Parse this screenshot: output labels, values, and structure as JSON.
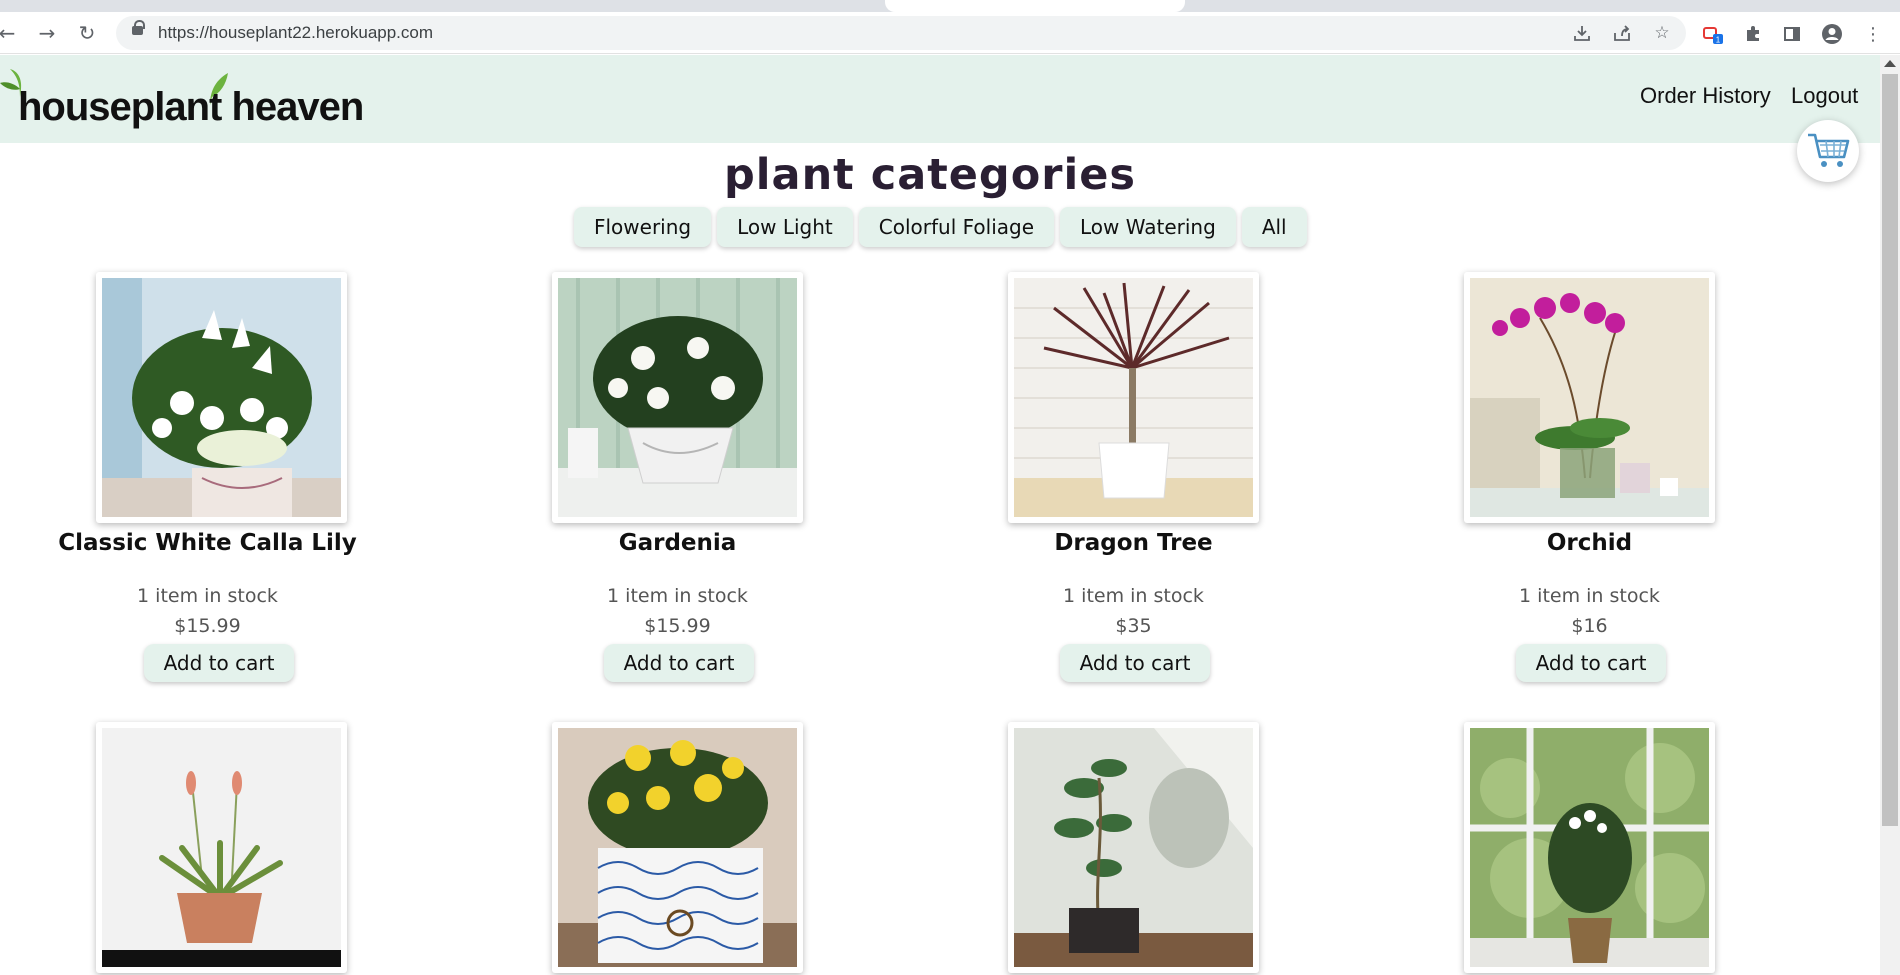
{
  "browser": {
    "url": "https://houseplant22.herokuapp.com",
    "extension_badge": "1"
  },
  "header": {
    "logo_text": "houseplant heaven",
    "nav": {
      "order_history": "Order History",
      "logout": "Logout"
    }
  },
  "main": {
    "title": "plant categories",
    "categories": [
      "Flowering",
      "Low Light",
      "Colorful Foliage",
      "Low Watering",
      "All"
    ],
    "products": [
      {
        "name": "Classic White Calla Lily",
        "stock": "1 item in stock",
        "price": "$15.99",
        "add_label": "Add to cart"
      },
      {
        "name": "Gardenia",
        "stock": "1 item in stock",
        "price": "$15.99",
        "add_label": "Add to cart"
      },
      {
        "name": "Dragon Tree",
        "stock": "1 item in stock",
        "price": "$35",
        "add_label": "Add to cart"
      },
      {
        "name": "Orchid",
        "stock": "1 item in stock",
        "price": "$16",
        "add_label": "Add to cart"
      }
    ]
  },
  "colors": {
    "header_bg": "#e4f2ec",
    "button_bg": "#e4f2ec",
    "title_color": "#2a1f33",
    "leaf_green": "#6cb33f"
  }
}
